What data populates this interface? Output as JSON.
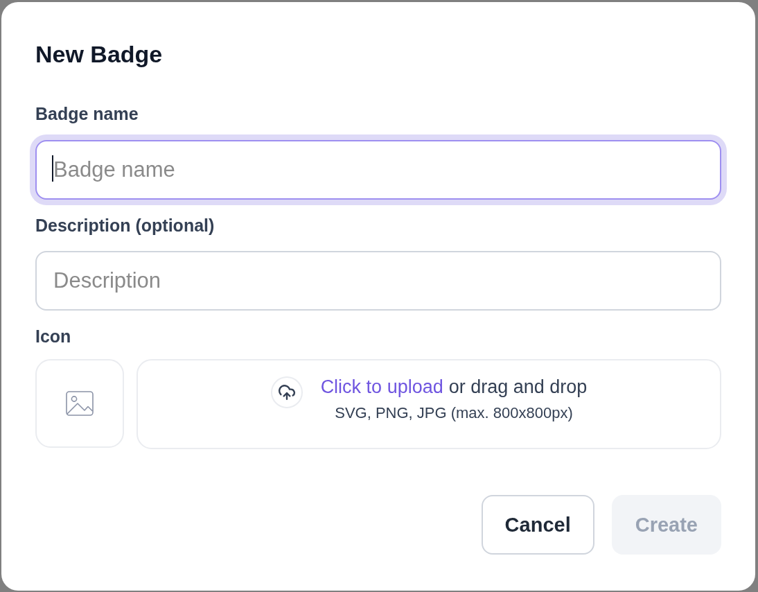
{
  "dialog": {
    "title": "New Badge"
  },
  "fields": [
    {
      "label": "Badge name",
      "placeholder": "Badge name",
      "focused": true
    },
    {
      "label": "Description (optional)",
      "placeholder": "Description",
      "focused": false
    }
  ],
  "icon_section": {
    "label": "Icon",
    "upload": {
      "link": "Click to upload",
      "text": "or drag and drop",
      "hint": "SVG, PNG, JPG (max. 800x800px)"
    }
  },
  "buttons": [
    {
      "label": "Cancel",
      "disabled": false
    },
    {
      "label": "Create",
      "disabled": true
    }
  ]
}
